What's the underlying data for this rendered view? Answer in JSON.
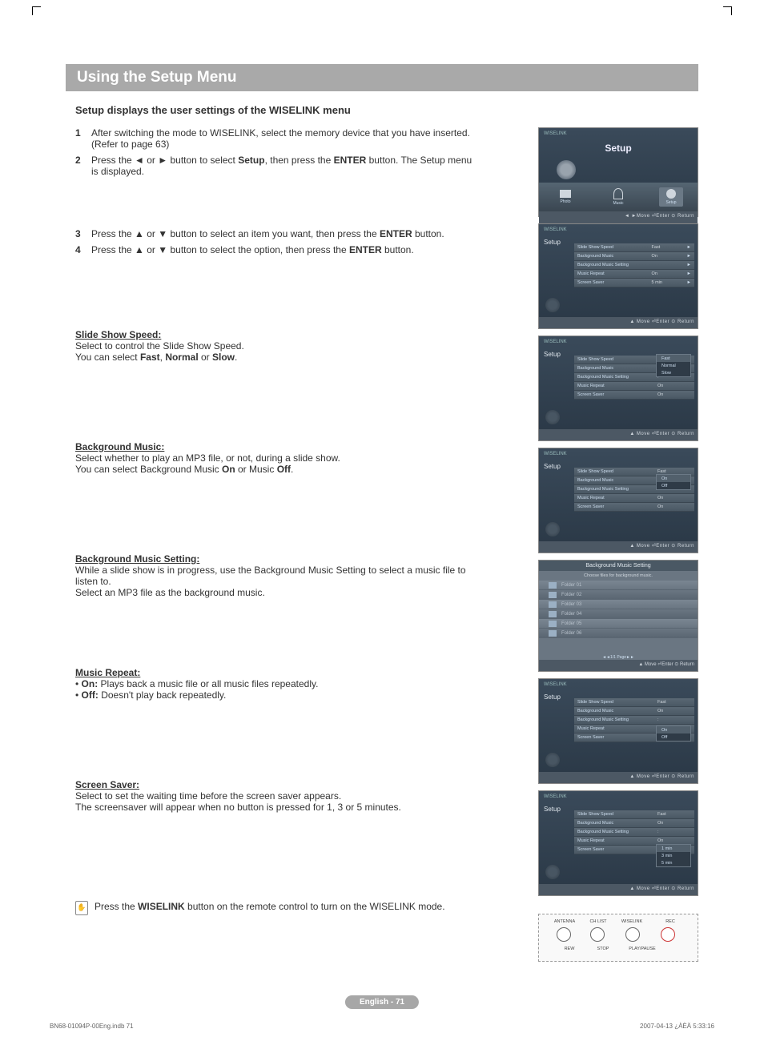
{
  "page": {
    "title": "Using the Setup Menu",
    "subtitle": "Setup displays the user settings of the WISELINK menu",
    "pill": "English - 71",
    "footer_left": "BN68-01094P-00Eng.indb   71",
    "footer_right": "2007-04-13   ¿ÀÈÄ 5:33:16"
  },
  "steps1": [
    {
      "num": "1",
      "text": "After switching the mode to WISELINK, select the memory device that you have inserted. (Refer to page 63)"
    },
    {
      "num": "2",
      "text_parts": [
        "Press the ",
        " or ",
        " button to select ",
        ", then press the ",
        " button. The Setup menu is displayed."
      ],
      "bold": [
        "Setup",
        "ENTER"
      ]
    }
  ],
  "steps2": [
    {
      "num": "3",
      "text_parts": [
        "Press the ",
        " or ",
        " button to select an item you want, then press the ",
        " button."
      ],
      "bold": [
        "ENTER"
      ]
    },
    {
      "num": "4",
      "text_parts": [
        "Press the ",
        " or ",
        " button to select the option, then press the ",
        " button."
      ],
      "bold": [
        "ENTER"
      ]
    }
  ],
  "sections": {
    "slide": {
      "head": "Slide Show Speed:",
      "line1": "Select to control the Slide Show Speed.",
      "line2_parts": [
        "You can select ",
        ", ",
        " or ",
        "."
      ],
      "bold": [
        "Fast",
        "Normal",
        "Slow"
      ]
    },
    "bgm": {
      "head": "Background Music:",
      "line1": "Select whether to play an MP3 file, or not, during a slide show.",
      "line2_parts": [
        "You can select Background Music ",
        " or Music ",
        "."
      ],
      "bold": [
        "On",
        "Off"
      ]
    },
    "bgms": {
      "head": "Background Music Setting:",
      "line1": "While a slide show is in progress, use the Background Music Setting to select a music file to listen to.",
      "line2": "Select an MP3 file as the background music."
    },
    "repeat": {
      "head": "Music Repeat:",
      "on_label": "On:",
      "on_text": " Plays back a music file or all music files repeatedly.",
      "off_label": "Off:",
      "off_text": " Doesn't play back repeatedly."
    },
    "saver": {
      "head": "Screen Saver:",
      "line1": "Select to set the waiting time before the screen saver appears.",
      "line2": "The screensaver will appear when no button is pressed for 1, 3 or 5 minutes."
    }
  },
  "tip": {
    "text_parts": [
      "Press the ",
      " button on the remote control to turn on the WISELINK mode."
    ],
    "bold": [
      "WISELINK"
    ]
  },
  "ui": {
    "brand": "WISELINK",
    "setup_title": "Setup",
    "nav_photo": "Photo",
    "nav_music": "Music",
    "nav_setup": "Setup",
    "footer_a": "◄ ►Move    ⏎Enter   ⊙ Return",
    "footer_b": "▲ Move    ⏎Enter   ⊙ Return",
    "menu": {
      "slide": "Slide Show Speed",
      "bgm": "Background Music",
      "bgms": "Background Music Setting",
      "repeat": "Music Repeat",
      "saver": "Screen Saver"
    },
    "vals": {
      "fast": "Fast",
      "normal": "Normal",
      "slow": "Slow",
      "on": "On",
      "off": "Off",
      "min5": "5 min",
      "min1": "1 min",
      "min3": "3 min",
      "min5b": "5 min"
    }
  },
  "music_setting": {
    "title": "Background Music Setting",
    "hint": "Choose files for background music.",
    "folders": [
      "Folder 01",
      "Folder 02",
      "Folder 03",
      "Folder 04",
      "Folder 05",
      "Folder 06"
    ],
    "pager": "◄◄1/1 Page►►"
  },
  "remote": {
    "labels": [
      "ANTENNA",
      "CH LIST",
      "WISELINK",
      "REC",
      "REW",
      "STOP",
      "PLAY/PAUSE"
    ]
  }
}
